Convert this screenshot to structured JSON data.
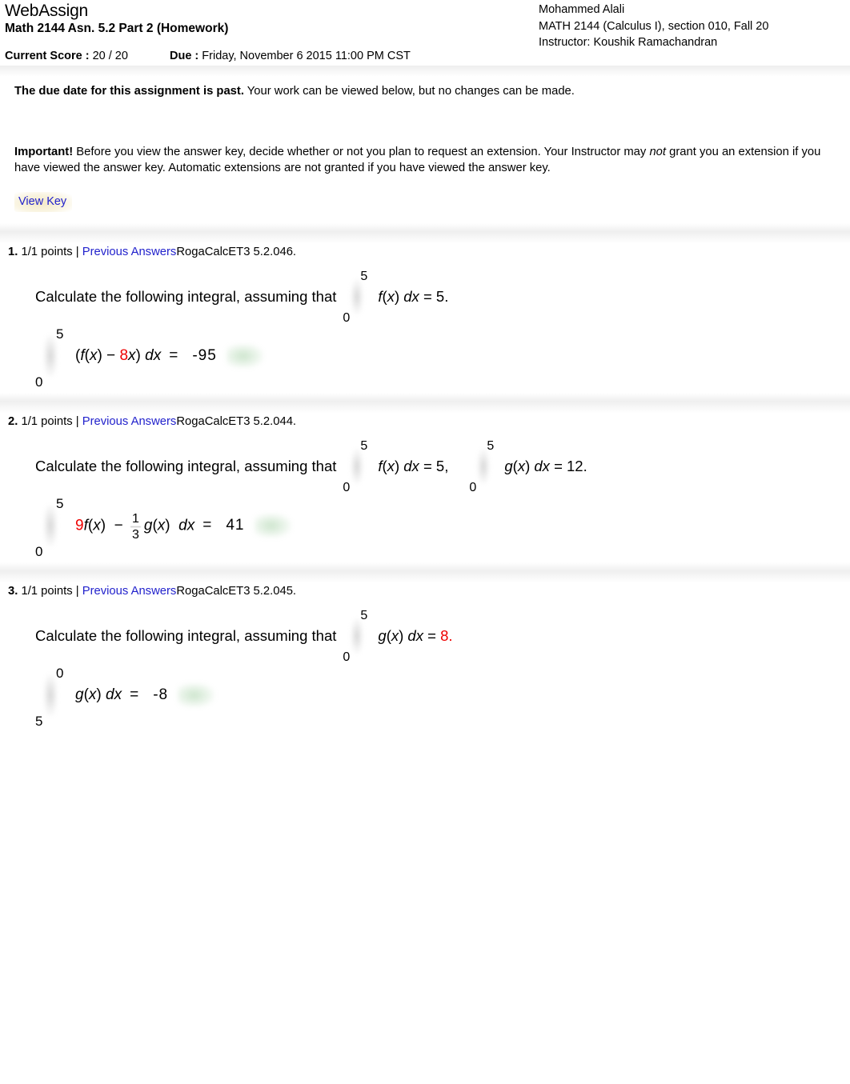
{
  "header": {
    "product": "WebAssign",
    "assignment_title": "Math 2144 Asn. 5.2 Part 2 (Homework)",
    "student_name": "Mohammed Alali",
    "course_line": "MATH 2144 (Calculus I), section 010, Fall 20",
    "instructor_line": "Instructor: Koushik Ramachandran",
    "current_score_label": "Current Score :",
    "current_score_value": "20 / 20",
    "due_label": "Due :",
    "due_value": "Friday, November 6 2015 11:00 PM CST"
  },
  "notice": {
    "past_due_bold": "The due date for this assignment is past.",
    "past_due_rest": "Your work can be viewed below, but no changes can be made.",
    "important_bold": "Important!",
    "important_part1": "Before you view the answer key, decide whether or not you plan to request an extension. Your Instructor may",
    "important_italic": "not",
    "important_part2": "grant you an extension if you have viewed the answer key. Automatic extensions are not granted if you have viewed the answer key.",
    "view_key_label": "View Key",
    "link_color": "#2222cc"
  },
  "questions": [
    {
      "number": "1.",
      "points": "1/1 points |",
      "previous_answers": "Previous Answers",
      "code": "RogaCalcET3 5.2.046.",
      "prompt": "Calculate the following integral, assuming that",
      "givens": [
        {
          "lower": "0",
          "upper": "5",
          "integrand_fn": "f",
          "integrand_var": "x",
          "dx": "dx",
          "equals": "=",
          "value": "5.",
          "value_color": "#000000"
        }
      ],
      "answer": {
        "lower": "0",
        "upper": "5",
        "expr_open": "(",
        "expr_fn": "f",
        "expr_var": "x",
        "expr_close_paren": ")",
        "expr_minus": "−",
        "expr_coef": "8",
        "expr_coef_color": "#ee0000",
        "expr_coef_var": "x",
        "expr_end": ")",
        "dx": "dx",
        "equals": "=",
        "value": "-95",
        "status": "correct"
      }
    },
    {
      "number": "2.",
      "points": "1/1 points |",
      "previous_answers": "Previous Answers",
      "code": "RogaCalcET3 5.2.044.",
      "prompt": "Calculate the following integral, assuming that",
      "givens": [
        {
          "lower": "0",
          "upper": "5",
          "integrand_fn": "f",
          "integrand_var": "x",
          "dx": "dx",
          "equals": "=",
          "value": "5,",
          "value_color": "#000000"
        },
        {
          "lower": "0",
          "upper": "5",
          "integrand_fn": "g",
          "integrand_var": "x",
          "dx": "dx",
          "equals": "=",
          "value": "12.",
          "value_color": "#000000"
        }
      ],
      "answer": {
        "lower": "0",
        "upper": "5",
        "coef1": "9",
        "coef1_color": "#ee0000",
        "fn1": "f",
        "var1": "x",
        "minus": "−",
        "frac_num": "1",
        "frac_den": "3",
        "fn2": "g",
        "var2": "x",
        "dx": "dx",
        "equals": "=",
        "value": "41",
        "status": "correct"
      }
    },
    {
      "number": "3.",
      "points": "1/1 points |",
      "previous_answers": "Previous Answers",
      "code": "RogaCalcET3 5.2.045.",
      "prompt": "Calculate the following integral, assuming that",
      "givens": [
        {
          "lower": "0",
          "upper": "5",
          "integrand_fn": "g",
          "integrand_var": "x",
          "dx": "dx",
          "equals": "=",
          "value": "8.",
          "value_color": "#ee0000"
        }
      ],
      "answer": {
        "lower": "5",
        "upper": "0",
        "fn": "g",
        "var": "x",
        "dx": "dx",
        "equals": "=",
        "value": "-8",
        "status": "correct"
      }
    }
  ]
}
